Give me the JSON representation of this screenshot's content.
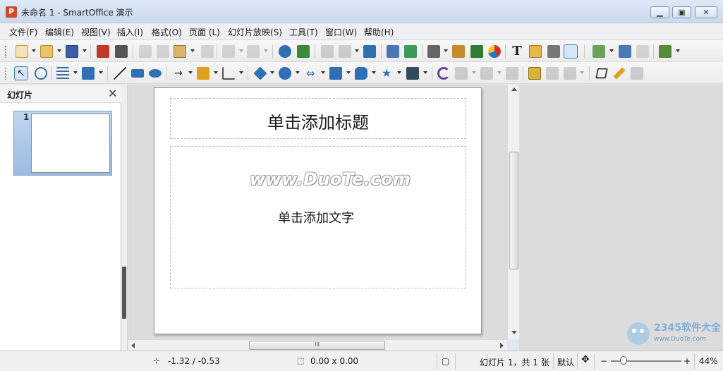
{
  "window": {
    "title": "未命名 1 - SmartOffice 演示",
    "app_icon_letter": "P"
  },
  "menu": [
    "文件(F)",
    "编辑(E)",
    "视图(V)",
    "插入(I)",
    "格式(O)",
    "页面 (L)",
    "幻灯片放映(S)",
    "工具(T)",
    "窗口(W)",
    "帮助(H)"
  ],
  "panel": {
    "title": "幻灯片",
    "close_glyph": "✕",
    "slide_number": "1"
  },
  "slide": {
    "title_placeholder": "单击添加标题",
    "body_placeholder": "单击添加文字"
  },
  "watermark": {
    "text": "www.DuoTe.com",
    "corner_site": "2345软件大全",
    "corner_url": "www.DuoTe.com"
  },
  "status": {
    "position": "-1.32 / -0.53",
    "size": "0.00 x 0.00",
    "slide_info": "幻灯片 1，共 1 张",
    "layout": "默认",
    "zoom": "44%"
  },
  "scrollbar_grip": "III",
  "colors": {
    "accent": "#3c7fb1",
    "app_icon": "#d24726",
    "thumb_bg": "#9bbbe0"
  }
}
